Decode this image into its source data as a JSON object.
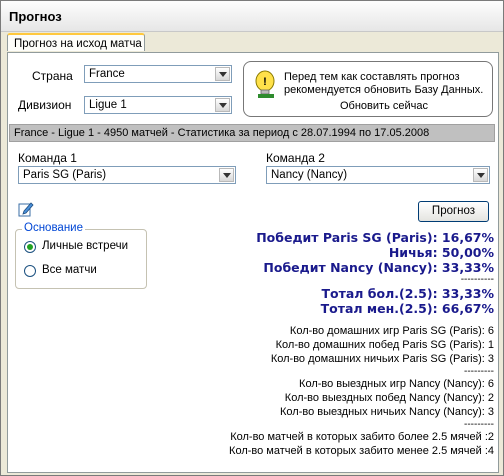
{
  "window": {
    "title": "Прогноз"
  },
  "tabs": [
    {
      "label": "Прогноз на исход матча"
    }
  ],
  "form": {
    "country_label": "Страна",
    "country_value": "France",
    "division_label": "Дивизион",
    "division_value": "Ligue 1"
  },
  "notice": {
    "message": "Перед тем как составлять прогноз рекомендуется обновить Базу Данных.",
    "update_link": "Обновить сейчас"
  },
  "info_bar": "France - Ligue 1 - 4950 матчей - Статистика за период с 28.07.1994 по 17.05.2008",
  "teams": {
    "team1_label": "Команда 1",
    "team1_value": "Paris SG (Paris)",
    "team2_label": "Команда 2",
    "team2_value": "Nancy (Nancy)"
  },
  "basis": {
    "legend": "Основание",
    "options": [
      "Личные встречи",
      "Все матчи"
    ],
    "selected": "Личные встречи"
  },
  "predict_button": "Прогноз",
  "results": {
    "win1": "Победит Paris SG (Paris): 16,67%",
    "draw": "Ничья: 50,00%",
    "win2": "Победит Nancy (Nancy): 33,33%",
    "separator": "----------",
    "total_over": "Тотал бол.(2.5): 33,33%",
    "total_under": "Тотал мен.(2.5): 66,67%"
  },
  "stats": {
    "home_games": "Кол-во домашних игр Paris SG (Paris): 6",
    "home_wins": "Кол-во домашних побед Paris SG (Paris): 1",
    "home_draws": "Кол-во домашних ничьих Paris SG (Paris): 3",
    "separator1": "---------",
    "away_games": "Кол-во выездных игр Nancy (Nancy): 6",
    "away_wins": "Кол-во выездных побед Nancy (Nancy): 2",
    "away_draws": "Кол-во выездных ничьих Nancy (Nancy): 3",
    "separator2": "---------",
    "over_matches": "Кол-во матчей в которых забито более 2.5 мячей :2",
    "under_matches": "Кол-во матчей в которых забито менее 2.5 мячей :4"
  },
  "icons": {
    "warning": "warning-lightbulb-icon",
    "edit": "edit-icon"
  },
  "colors": {
    "result_text": "#1a1a8c",
    "radio_selected": "#21a121",
    "legend": "#0046d5"
  }
}
